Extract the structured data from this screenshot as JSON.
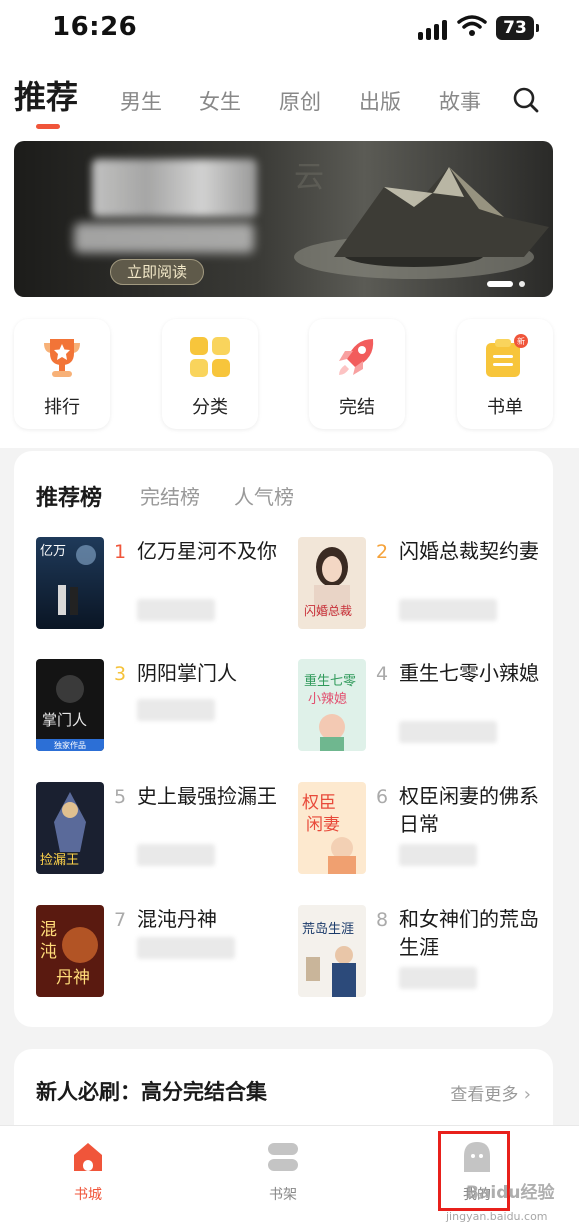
{
  "status_bar": {
    "time": "16:26",
    "battery": "73"
  },
  "top_tabs": {
    "active": "推荐",
    "items": [
      "男生",
      "女生",
      "原创",
      "出版",
      "故事"
    ]
  },
  "banner": {
    "read_button": "立即阅读"
  },
  "quick_entries": [
    "排行",
    "分类",
    "完结",
    "书单"
  ],
  "quick_badge": "新",
  "ranking": {
    "tabs": [
      "推荐榜",
      "完结榜",
      "人气榜"
    ],
    "books": [
      {
        "rank": "1",
        "title": "亿万星河不及你"
      },
      {
        "rank": "2",
        "title": "闪婚总裁契约妻"
      },
      {
        "rank": "3",
        "title": "阴阳掌门人"
      },
      {
        "rank": "4",
        "title": "重生七零小辣媳"
      },
      {
        "rank": "5",
        "title": "史上最强捡漏王"
      },
      {
        "rank": "6",
        "title": "权臣闲妻的佛系日常"
      },
      {
        "rank": "7",
        "title": "混沌丹神"
      },
      {
        "rank": "8",
        "title": "和女神们的荒岛生涯"
      }
    ]
  },
  "new_user": {
    "title": "新人必刷：高分完结合集",
    "more": "查看更多"
  },
  "bottom_nav": [
    "书城",
    "书架",
    "我的"
  ],
  "watermark": {
    "main": "Baidu经验",
    "sub": "jingyan.baidu.com"
  },
  "colors": {
    "accent": "#f0553a",
    "rank_top": "#f0553a",
    "rank_mid": "#f5a23a",
    "rank_low": "#aaaaaa",
    "highlight": "#e8201b"
  }
}
